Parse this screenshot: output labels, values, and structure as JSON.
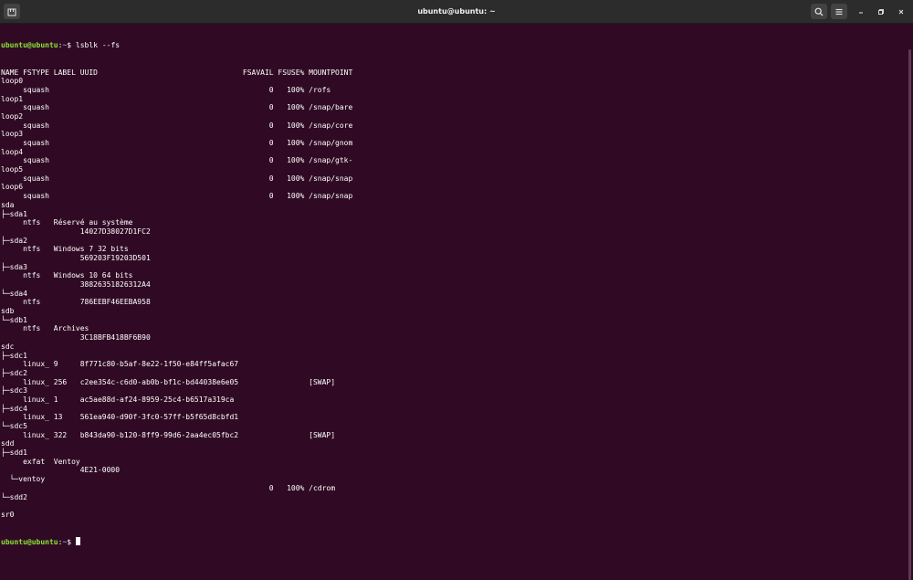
{
  "window": {
    "title": "ubuntu@ubuntu: ~"
  },
  "titlebar_icons": {
    "new_tab": "new-tab-icon",
    "search": "search-icon",
    "menu": "hamburger-menu-icon",
    "minimize": "minimize-icon",
    "maximize": "maximize-icon",
    "close": "close-icon"
  },
  "prompt": {
    "user_host": "ubuntu@ubuntu",
    "separator": ":",
    "path": "~",
    "symbol": "$ "
  },
  "command": "lsblk --fs",
  "output_lines": [
    "NAME FSTYPE LABEL UUID                                 FSAVAIL FSUSE% MOUNTPOINT",
    "loop0",
    "     squash                                                  0   100% /rofs",
    "loop1",
    "     squash                                                  0   100% /snap/bare",
    "loop2",
    "     squash                                                  0   100% /snap/core",
    "loop3",
    "     squash                                                  0   100% /snap/gnom",
    "loop4",
    "     squash                                                  0   100% /snap/gtk-",
    "loop5",
    "     squash                                                  0   100% /snap/snap",
    "loop6",
    "     squash                                                  0   100% /snap/snap",
    "sda",
    "├─sda1",
    "     ntfs   Réservé au système",
    "                  14027D38027D1FC2",
    "├─sda2",
    "     ntfs   Windows 7 32 bits",
    "                  569203F19203D501",
    "├─sda3",
    "     ntfs   Windows 10 64 bits",
    "                  38826351826312A4",
    "└─sda4",
    "     ntfs         786EEBF46EEBA958",
    "sdb",
    "└─sdb1",
    "     ntfs   Archives",
    "                  3C18BFB418BF6B90",
    "sdc",
    "├─sdc1",
    "     linux_ 9     8f771c80-b5af-8e22-1f50-e84ff5afac67",
    "├─sdc2",
    "     linux_ 256   c2ee354c-c6d0-ab0b-bf1c-bd44038e6e05                [SWAP]",
    "├─sdc3",
    "     linux_ 1     ac5ae88d-af24-8959-25c4-b6517a319ca",
    "├─sdc4",
    "     linux_ 13    561ea940-d90f-3fc0-57ff-b5f65d8cbfd1",
    "└─sdc5",
    "     linux_ 322   b843da90-b120-8ff9-99d6-2aa4ec05fbc2                [SWAP]",
    "sdd",
    "├─sdd1",
    "     exfat  Ventoy",
    "                  4E21-0000",
    "  └─ventoy",
    "                                                             0   100% /cdrom",
    "└─sdd2",
    "",
    "sr0"
  ]
}
